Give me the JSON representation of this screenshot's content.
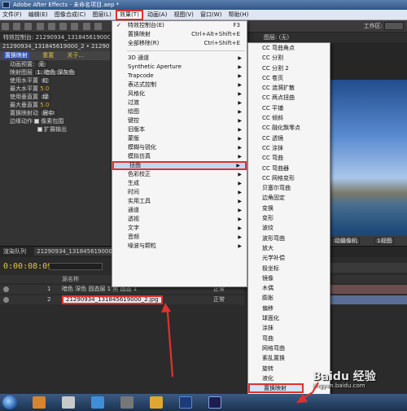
{
  "window": {
    "title": "Adobe After Effects - 未命名项目.aep *"
  },
  "menubar": [
    "文件(F)",
    "编辑(E)",
    "图像合成(C)",
    "图层(L)",
    "效果(T)",
    "动画(A)",
    "视图(V)",
    "窗口(W)",
    "帮助(H)"
  ],
  "toolbar": {
    "workspace_label": "工作区:",
    "workspace_value": "标准"
  },
  "effect_panel": {
    "tab": "特效控制台: 21290934_131845619000_",
    "layer": "21290934_131845619000_2 • 21290934_13184561900",
    "effect_name": "置换映射",
    "reset": "重置",
    "about": "关于...",
    "props": [
      {
        "label": "动画预置:",
        "value": "无"
      },
      {
        "label": "映射图层",
        "value": "1. 暗色 深灰色"
      },
      {
        "label": "使用水平置",
        "value": "红"
      },
      {
        "label": "最大水平置",
        "value": "5.0"
      },
      {
        "label": "使用垂直置",
        "value": "绿"
      },
      {
        "label": "最大垂直置",
        "value": "5.0"
      },
      {
        "label": "置换映射动",
        "value": "居中"
      },
      {
        "label": "边缘动作",
        "value": "像素包围"
      },
      {
        "label": "",
        "value": "扩展输出"
      }
    ]
  },
  "comp_panel": {
    "tab": "图层: (无)",
    "camera": "动摄像机",
    "view": "1视图"
  },
  "timeline": {
    "tabs": [
      "渲染队列",
      "21290934_131845619000_2",
      "21290934_131845619000_2"
    ],
    "timecode": "0:00:08:09",
    "col_source": "源名称",
    "col_mode": "模式",
    "ruler": "",
    "layers": [
      {
        "num": "1",
        "name": "暗色 深色 固态层 1 黑 固态 1",
        "mode": "正常"
      },
      {
        "num": "2",
        "name": "21290934_131845619000_2.jpg",
        "mode": "正常"
      }
    ]
  },
  "effect_menu": {
    "items": [
      {
        "label": "特效控制台(E)",
        "shortcut": "F3",
        "check": true
      },
      {
        "label": "置换映射",
        "shortcut": "Ctrl+Alt+Shift+E"
      },
      {
        "label": "全部移除(R)",
        "shortcut": "Ctrl+Shift+E"
      }
    ],
    "categories": [
      "3D 通道",
      "Synthetic Aperture",
      "Trapcode",
      "表达式控制",
      "风格化",
      "过渡",
      "绘图",
      "键控",
      "旧版本",
      "蒙版",
      "模糊与锐化",
      "模拟仿真",
      "扭曲",
      "色彩校正",
      "生成",
      "时间",
      "实用工具",
      "通道",
      "透视",
      "文字",
      "音频",
      "噪波与颗粒"
    ],
    "highlighted": "扭曲"
  },
  "distort_submenu": {
    "items": [
      "CC 弯曲角点",
      "CC 分割",
      "CC 分割 2",
      "CC 卷页",
      "CC 涟漪扩散",
      "CC 两点扭曲",
      "CC 平铺",
      "CC 倾斜",
      "CC 融化飘零点",
      "CC 透镜",
      "CC 涂抹",
      "CC 弯曲",
      "CC 弯曲器",
      "CC 网格变形",
      "贝塞尔弯曲",
      "边角固定",
      "变换",
      "变形",
      "波纹",
      "波形弯曲",
      "放大",
      "光学补偿",
      "极坐标",
      "镜像",
      "木偶",
      "膨胀",
      "偏移",
      "球面化",
      "涂抹",
      "弯曲",
      "网格弯曲",
      "紊乱置换",
      "旋转",
      "液化",
      "置换映射"
    ],
    "highlighted": "置换映射"
  },
  "watermark": {
    "text": "Baidu 经验",
    "sub": "jingyan.baidu.com"
  },
  "colors": {
    "accent": "#e0322d",
    "timecode": "#e2c53a",
    "menu_bg": "#f5f5f5"
  }
}
